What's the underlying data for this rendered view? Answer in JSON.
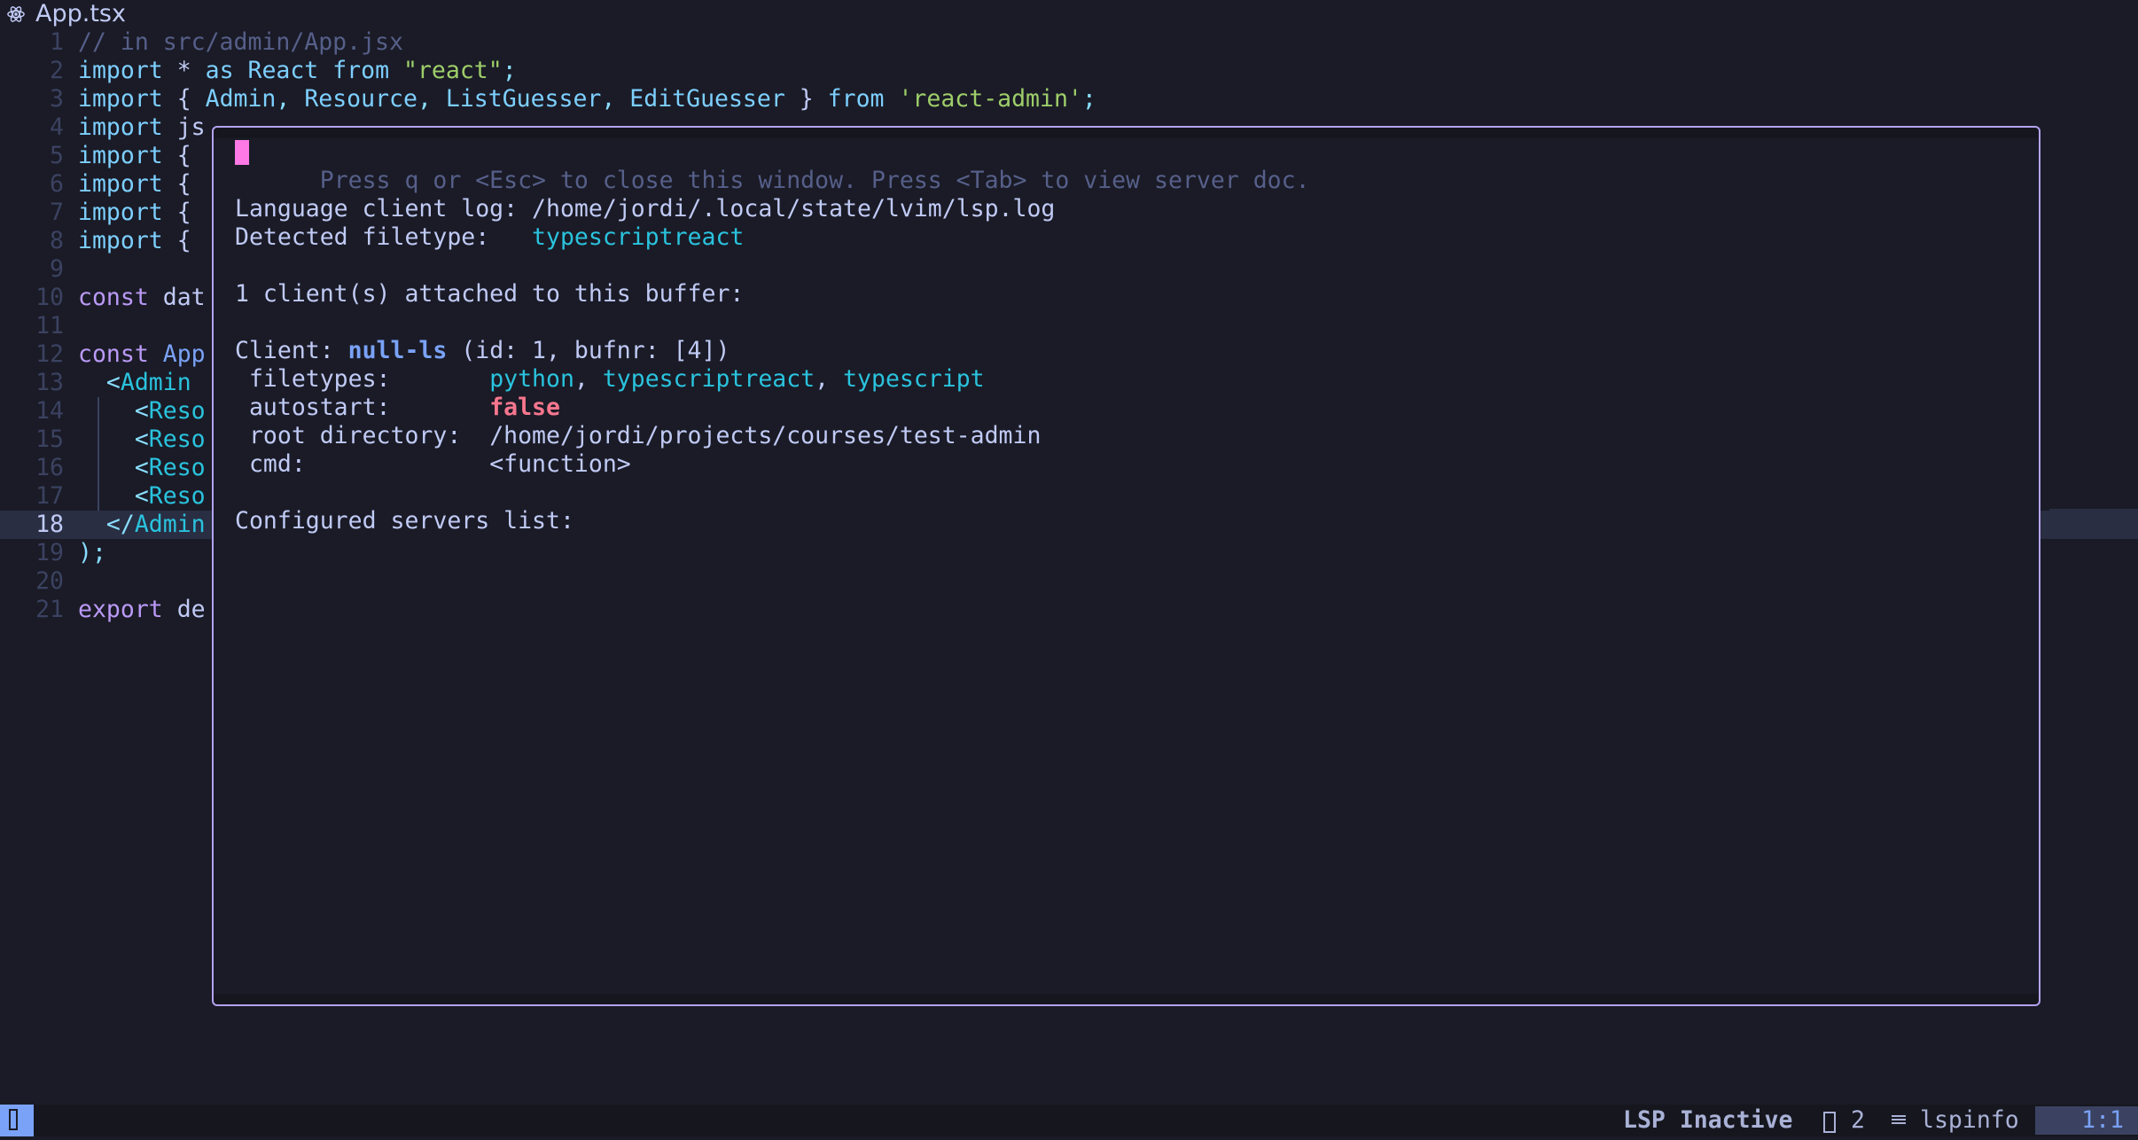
{
  "winbar": {
    "icon": "react-icon",
    "filename": "App.tsx"
  },
  "editor": {
    "lines": [
      {
        "n": "1",
        "parts": [
          [
            "c-comment",
            "// in src/admin/App.jsx"
          ]
        ]
      },
      {
        "n": "2",
        "parts": [
          [
            "c-import",
            "import"
          ],
          [
            "c-fg",
            " * "
          ],
          [
            "c-import",
            "as"
          ],
          [
            "c-ident",
            " React "
          ],
          [
            "c-import",
            "from"
          ],
          [
            "c-fg",
            " "
          ],
          [
            "c-str",
            "\"react\""
          ],
          [
            "c-punc",
            ";"
          ]
        ]
      },
      {
        "n": "3",
        "parts": [
          [
            "c-import",
            "import"
          ],
          [
            "c-fg",
            " { "
          ],
          [
            "c-ident",
            "Admin"
          ],
          [
            "c-punc",
            ", "
          ],
          [
            "c-ident",
            "Resource"
          ],
          [
            "c-punc",
            ", "
          ],
          [
            "c-ident",
            "ListGuesser"
          ],
          [
            "c-punc",
            ", "
          ],
          [
            "c-ident",
            "EditGuesser"
          ],
          [
            "c-fg",
            " } "
          ],
          [
            "c-import",
            "from"
          ],
          [
            "c-fg",
            " "
          ],
          [
            "c-str",
            "'react-admin'"
          ],
          [
            "c-punc",
            ";"
          ]
        ]
      },
      {
        "n": "4",
        "parts": [
          [
            "c-import",
            "import"
          ],
          [
            "c-fg",
            " js"
          ]
        ]
      },
      {
        "n": "5",
        "parts": [
          [
            "c-import",
            "import"
          ],
          [
            "c-fg",
            " {"
          ]
        ]
      },
      {
        "n": "6",
        "parts": [
          [
            "c-import",
            "import"
          ],
          [
            "c-fg",
            " {"
          ]
        ]
      },
      {
        "n": "7",
        "parts": [
          [
            "c-import",
            "import"
          ],
          [
            "c-fg",
            " {"
          ]
        ]
      },
      {
        "n": "8",
        "parts": [
          [
            "c-import",
            "import"
          ],
          [
            "c-fg",
            " {"
          ]
        ]
      },
      {
        "n": "9",
        "parts": []
      },
      {
        "n": "10",
        "parts": [
          [
            "c-kw",
            "const"
          ],
          [
            "c-fg",
            " dat"
          ]
        ]
      },
      {
        "n": "11",
        "parts": []
      },
      {
        "n": "12",
        "parts": [
          [
            "c-kw",
            "const"
          ],
          [
            "c-func",
            " App"
          ]
        ]
      },
      {
        "n": "13",
        "parts": [
          [
            "c-fg",
            "  "
          ],
          [
            "c-punc",
            "<"
          ],
          [
            "c-tag",
            "Admin"
          ]
        ]
      },
      {
        "n": "14",
        "parts": [
          [
            "c-fg",
            "    "
          ],
          [
            "c-punc",
            "<"
          ],
          [
            "c-tag",
            "Reso"
          ]
        ]
      },
      {
        "n": "15",
        "parts": [
          [
            "c-fg",
            "    "
          ],
          [
            "c-punc",
            "<"
          ],
          [
            "c-tag",
            "Reso"
          ]
        ]
      },
      {
        "n": "16",
        "parts": [
          [
            "c-fg",
            "    "
          ],
          [
            "c-punc",
            "<"
          ],
          [
            "c-tag",
            "Reso"
          ]
        ]
      },
      {
        "n": "17",
        "parts": [
          [
            "c-fg",
            "    "
          ],
          [
            "c-punc",
            "<"
          ],
          [
            "c-tag",
            "Reso"
          ]
        ]
      },
      {
        "n": "18",
        "parts": [
          [
            "c-fg",
            "  "
          ],
          [
            "c-punc",
            "</"
          ],
          [
            "c-tag",
            "Admin"
          ]
        ],
        "current": true
      },
      {
        "n": "19",
        "parts": [
          [
            "c-punc",
            ");"
          ]
        ]
      },
      {
        "n": "20",
        "parts": []
      },
      {
        "n": "21",
        "parts": [
          [
            "c-kw",
            "export"
          ],
          [
            "c-fg",
            " de"
          ]
        ]
      }
    ]
  },
  "lspinfo": {
    "hint": "Press q or <Esc> to close this window. Press <Tab> to view server doc.",
    "log_label": "Language client log: ",
    "log_path": "/home/jordi/.local/state/lvim/lsp.log",
    "ft_label": "Detected filetype:   ",
    "ft_value": "typescriptreact",
    "attached": "1 client(s) attached to this buffer:",
    "client_label": "Client: ",
    "client_name": "null-ls",
    "client_meta": " (id: 1, bufnr: [4])",
    "filetypes_label": " filetypes:       ",
    "filetypes": [
      "python",
      "typescriptreact",
      "typescript"
    ],
    "filetypes_sep": ", ",
    "autostart_label": " autostart:       ",
    "autostart_value": "false",
    "root_label": " root directory:  ",
    "root_value": "/home/jordi/projects/courses/test-admin",
    "cmd_label": " cmd:             ",
    "cmd_value": "<function>",
    "configured": "Configured servers list:"
  },
  "statusline": {
    "lsp": "LSP Inactive",
    "buf_count": "2",
    "filetype": "lspinfo",
    "position": "1:1"
  },
  "colors": {
    "background": "#1a1b26",
    "float_border": "#b4a2f0",
    "cursor": "#ff79e6",
    "mode_block": "#7aa2f7"
  }
}
